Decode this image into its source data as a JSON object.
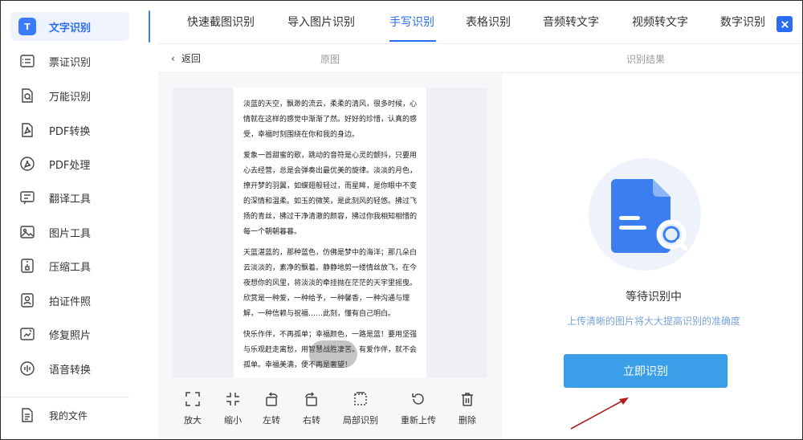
{
  "sidebar": {
    "items": [
      {
        "label": "文字识别",
        "icon": "text-recognition-icon",
        "badge": "T",
        "active": true
      },
      {
        "label": "票证识别",
        "icon": "ticket-icon"
      },
      {
        "label": "万能识别",
        "icon": "universal-scan-icon"
      },
      {
        "label": "PDF转换",
        "icon": "pdf-convert-icon"
      },
      {
        "label": "PDF处理",
        "icon": "pdf-process-icon"
      },
      {
        "label": "翻译工具",
        "icon": "translate-icon"
      },
      {
        "label": "图片工具",
        "icon": "image-tool-icon"
      },
      {
        "label": "压缩工具",
        "icon": "compress-icon"
      },
      {
        "label": "拍证件照",
        "icon": "id-photo-icon"
      },
      {
        "label": "修复照片",
        "icon": "photo-repair-icon"
      },
      {
        "label": "语音转换",
        "icon": "voice-convert-icon"
      }
    ],
    "my_files": {
      "label": "我的文件",
      "icon": "file-icon"
    }
  },
  "tabs": [
    {
      "label": "快速截图识别"
    },
    {
      "label": "导入图片识别"
    },
    {
      "label": "手写识别",
      "active": true
    },
    {
      "label": "表格识别"
    },
    {
      "label": "音频转文字"
    },
    {
      "label": "视频转文字"
    },
    {
      "label": "数字识别"
    }
  ],
  "subheader": {
    "back_label": "返回",
    "original_label": "原图",
    "result_label": "识别结果"
  },
  "document": {
    "paragraphs": [
      "淡蓝的天空，飘渺的流云，柔柔的清风，很多时候，心情就在这样的感觉中渐渐了然。好好的珍惜，认真的感受，幸福时刻围绕在你和我的身边。",
      "爱象一首甜蜜的歌，跳动的音符是心灵的颤抖，只要用心去经营，总是会弹奏出最优美的旋律。淡淡的月色，撩开梦的羽翼，如蝶翅般轻过，而星眸，是你眼中不变的深情和温柔。如玉的微笑，是此刻风的轻悠。拂过飞扬的青丝，拂过干净清澈的颜容，拂过你我相知相惜的每一个朝朝暮暮。",
      "天蓝湛蓝的，那种蓝色，仿佛是梦中的海洋；那几朵白云淡淡的，素净的飘着。静静地剪一缕情丝放飞，在今夜想你的风里，将淡淡的牵挂抛在茫茫的天宇里摇曳。欣赏是一种爱，一种给予，一种馨香，一种沟通与理解，一种信赖与祝福……此刻，懂有自己明白。",
      "快乐作伴，不再孤单；幸福颜色，一路是蓝！要用坚强与乐观赶走离愁，用智慧战胜凄苦。有爱作伴，就不会孤单。幸福美满，便不再是奢望！"
    ]
  },
  "toolbar": [
    {
      "label": "放大",
      "icon": "zoom-in-icon"
    },
    {
      "label": "缩小",
      "icon": "zoom-out-icon"
    },
    {
      "label": "左转",
      "icon": "rotate-left-icon"
    },
    {
      "label": "右转",
      "icon": "rotate-right-icon"
    },
    {
      "label": "局部识别",
      "icon": "crop-icon"
    },
    {
      "label": "重新上传",
      "icon": "reupload-icon"
    },
    {
      "label": "删除",
      "icon": "delete-icon"
    }
  ],
  "result": {
    "status_title": "等待识别中",
    "hint": "上传清晰的图片将大大提高识别的准确度",
    "button_label": "立即识别"
  },
  "colors": {
    "accent": "#2a6df4",
    "button": "#3a9ee8",
    "annotation_arrow": "#b02020"
  }
}
